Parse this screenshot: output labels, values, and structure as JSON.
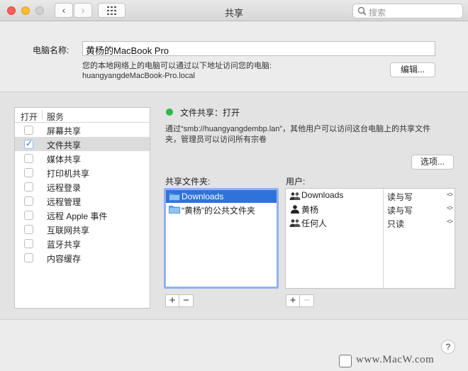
{
  "window": {
    "title": "共享"
  },
  "search": {
    "placeholder": "搜索"
  },
  "computer_name": {
    "label": "电脑名称:",
    "value": "黄杨的MacBook Pro",
    "desc_line1": "您的本地网络上的电脑可以通过以下地址访问您的电脑:",
    "desc_line2": "huangyangdeMacBook-Pro.local",
    "edit_label": "编辑..."
  },
  "services": {
    "header_on": "打开",
    "header_service": "服务",
    "items": [
      {
        "label": "屏幕共享",
        "checked": false
      },
      {
        "label": "文件共享",
        "checked": true,
        "selected": true
      },
      {
        "label": "媒体共享",
        "checked": false
      },
      {
        "label": "打印机共享",
        "checked": false
      },
      {
        "label": "远程登录",
        "checked": false
      },
      {
        "label": "远程管理",
        "checked": false
      },
      {
        "label": "远程 Apple 事件",
        "checked": false
      },
      {
        "label": "互联网共享",
        "checked": false
      },
      {
        "label": "蓝牙共享",
        "checked": false
      },
      {
        "label": "内容缓存",
        "checked": false
      }
    ]
  },
  "status": {
    "text": "文件共享：打开",
    "color": "#2cb94a",
    "info_line1": "通过“smb://huangyangdembp.lan”，其他用户可以访问这台电脑上的共享文件",
    "info_line2": "夹，管理员可以访问所有宗卷"
  },
  "options_label": "选项...",
  "shared_folders": {
    "label": "共享文件夹:",
    "items": [
      {
        "label": "Downloads",
        "selected": true
      },
      {
        "label": "“黄杨”的公共文件夹",
        "selected": false
      }
    ]
  },
  "users": {
    "label": "用户:",
    "items": [
      {
        "name": "Downloads",
        "icon": "group-icon",
        "perm": "读与写"
      },
      {
        "name": "黄杨",
        "icon": "person-icon",
        "perm": "读与写"
      },
      {
        "name": "任何人",
        "icon": "group-icon",
        "perm": "只读"
      }
    ]
  },
  "buttons": {
    "plus": "+",
    "minus": "−",
    "help": "?"
  },
  "watermark": {
    "text": "www.MacW.com"
  },
  "colors": {
    "accent": "#2f73da",
    "folder_blue": "#5aa0e0"
  }
}
